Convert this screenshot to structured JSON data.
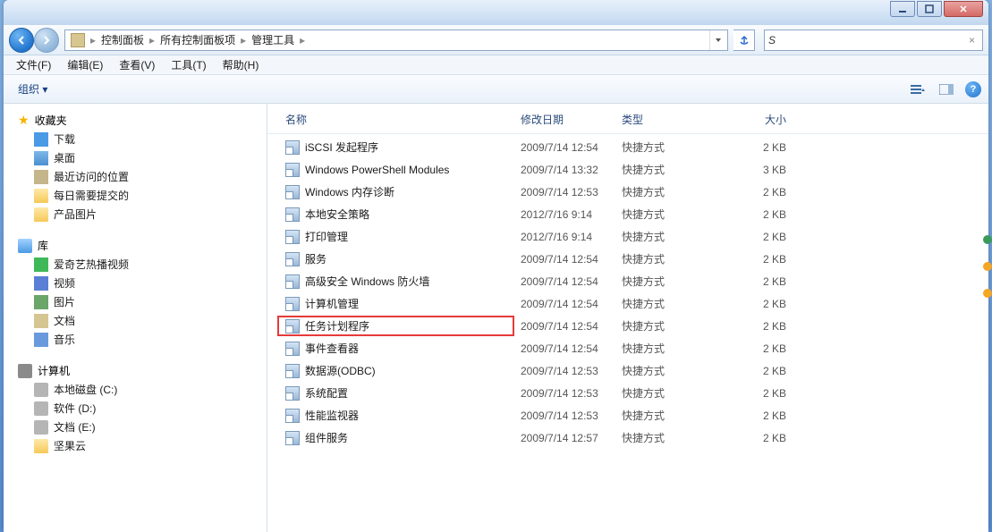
{
  "window_controls": {
    "minimize": "minimize",
    "maximize": "maximize",
    "close": "close"
  },
  "breadcrumb": [
    "控制面板",
    "所有控制面板项",
    "管理工具"
  ],
  "search": {
    "value": "S",
    "clear": "×"
  },
  "menubar": [
    "文件(F)",
    "编辑(E)",
    "查看(V)",
    "工具(T)",
    "帮助(H)"
  ],
  "toolbar": {
    "organize": "组织 ▾"
  },
  "sidebar": {
    "favorites": {
      "label": "收藏夹",
      "items": [
        "下载",
        "桌面",
        "最近访问的位置",
        "每日需要提交的",
        "产品图片"
      ]
    },
    "libraries": {
      "label": "库",
      "items": [
        "爱奇艺热播视频",
        "视频",
        "图片",
        "文档",
        "音乐"
      ]
    },
    "computer": {
      "label": "计算机",
      "items": [
        "本地磁盘 (C:)",
        "软件 (D:)",
        "文档 (E:)",
        "坚果云"
      ]
    }
  },
  "columns": {
    "name": "名称",
    "date": "修改日期",
    "type": "类型",
    "size": "大小"
  },
  "files": [
    {
      "name": "iSCSI 发起程序",
      "date": "2009/7/14 12:54",
      "type": "快捷方式",
      "size": "2 KB"
    },
    {
      "name": "Windows PowerShell Modules",
      "date": "2009/7/14 13:32",
      "type": "快捷方式",
      "size": "3 KB"
    },
    {
      "name": "Windows 内存诊断",
      "date": "2009/7/14 12:53",
      "type": "快捷方式",
      "size": "2 KB"
    },
    {
      "name": "本地安全策略",
      "date": "2012/7/16 9:14",
      "type": "快捷方式",
      "size": "2 KB"
    },
    {
      "name": "打印管理",
      "date": "2012/7/16 9:14",
      "type": "快捷方式",
      "size": "2 KB"
    },
    {
      "name": "服务",
      "date": "2009/7/14 12:54",
      "type": "快捷方式",
      "size": "2 KB"
    },
    {
      "name": "高级安全 Windows 防火墙",
      "date": "2009/7/14 12:54",
      "type": "快捷方式",
      "size": "2 KB"
    },
    {
      "name": "计算机管理",
      "date": "2009/7/14 12:54",
      "type": "快捷方式",
      "size": "2 KB"
    },
    {
      "name": "任务计划程序",
      "date": "2009/7/14 12:54",
      "type": "快捷方式",
      "size": "2 KB",
      "highlighted": true
    },
    {
      "name": "事件查看器",
      "date": "2009/7/14 12:54",
      "type": "快捷方式",
      "size": "2 KB"
    },
    {
      "name": "数据源(ODBC)",
      "date": "2009/7/14 12:53",
      "type": "快捷方式",
      "size": "2 KB"
    },
    {
      "name": "系统配置",
      "date": "2009/7/14 12:53",
      "type": "快捷方式",
      "size": "2 KB"
    },
    {
      "name": "性能监视器",
      "date": "2009/7/14 12:53",
      "type": "快捷方式",
      "size": "2 KB"
    },
    {
      "name": "组件服务",
      "date": "2009/7/14 12:57",
      "type": "快捷方式",
      "size": "2 KB"
    }
  ]
}
